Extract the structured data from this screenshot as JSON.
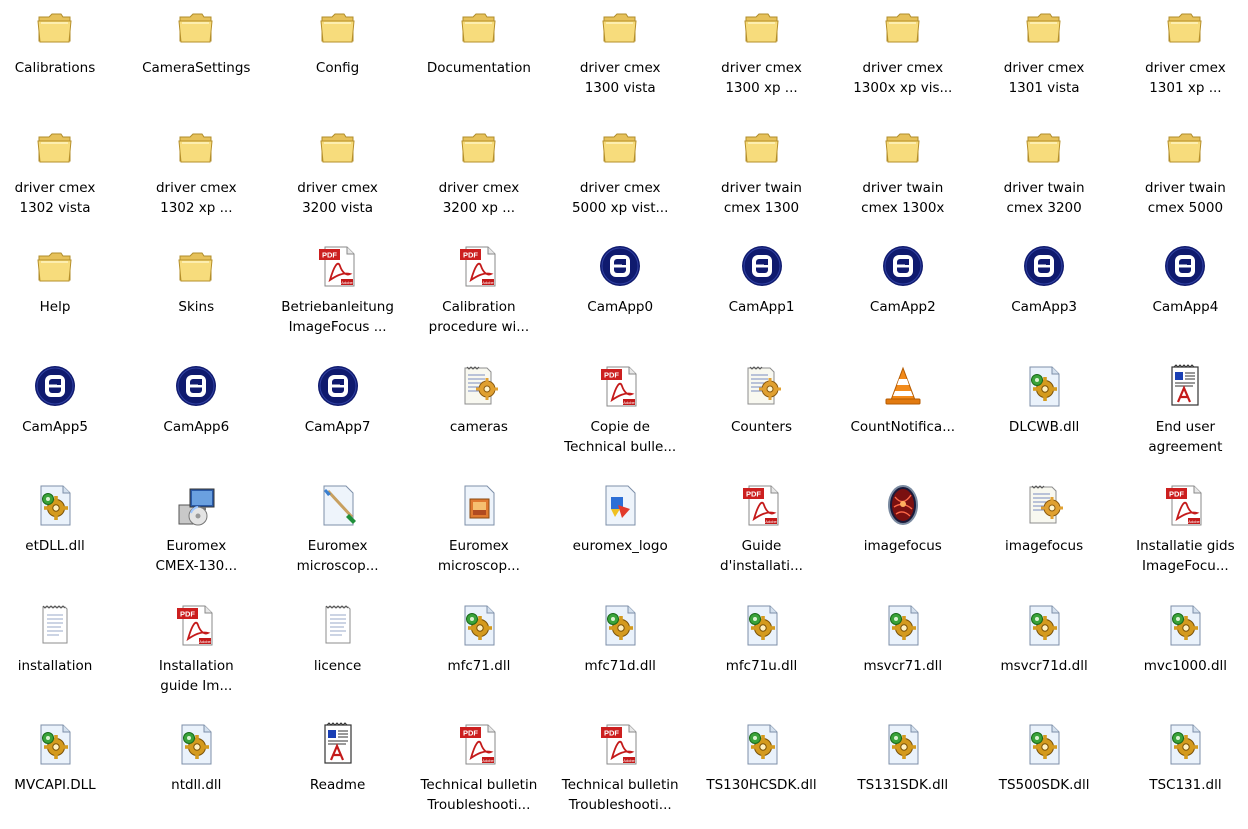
{
  "items": [
    {
      "label": "Calibrations",
      "icon": "folder-icon"
    },
    {
      "label": "CameraSettings",
      "icon": "folder-icon"
    },
    {
      "label": "Config",
      "icon": "folder-icon"
    },
    {
      "label": "Documentation",
      "icon": "folder-icon"
    },
    {
      "label": "driver cmex\n1300 vista",
      "icon": "folder-icon"
    },
    {
      "label": "driver cmex\n1300 xp ...",
      "icon": "folder-icon"
    },
    {
      "label": "driver cmex\n1300x xp vis...",
      "icon": "folder-icon"
    },
    {
      "label": "driver cmex\n1301 vista",
      "icon": "folder-icon"
    },
    {
      "label": "driver cmex\n1301 xp ...",
      "icon": "folder-icon"
    },
    {
      "label": "driver cmex\n1302 vista",
      "icon": "folder-icon"
    },
    {
      "label": "driver cmex\n1302 xp ...",
      "icon": "folder-icon"
    },
    {
      "label": "driver cmex\n3200 vista",
      "icon": "folder-icon"
    },
    {
      "label": "driver cmex\n3200 xp ...",
      "icon": "folder-icon"
    },
    {
      "label": "driver cmex\n5000 xp vist...",
      "icon": "folder-icon"
    },
    {
      "label": "driver twain\ncmex 1300",
      "icon": "folder-icon"
    },
    {
      "label": "driver twain\ncmex 1300x",
      "icon": "folder-icon"
    },
    {
      "label": "driver twain\ncmex 3200",
      "icon": "folder-icon"
    },
    {
      "label": "driver twain\ncmex 5000",
      "icon": "folder-icon"
    },
    {
      "label": "Help",
      "icon": "folder-icon"
    },
    {
      "label": "Skins",
      "icon": "folder-icon"
    },
    {
      "label": "Betriebanleitung\nImageFocus ...",
      "icon": "pdf-icon"
    },
    {
      "label": "Calibration\nprocedure wi...",
      "icon": "pdf-icon"
    },
    {
      "label": "CamApp0",
      "icon": "camapp-icon"
    },
    {
      "label": "CamApp1",
      "icon": "camapp-icon"
    },
    {
      "label": "CamApp2",
      "icon": "camapp-icon"
    },
    {
      "label": "CamApp3",
      "icon": "camapp-icon"
    },
    {
      "label": "CamApp4",
      "icon": "camapp-icon"
    },
    {
      "label": "CamApp5",
      "icon": "camapp-icon"
    },
    {
      "label": "CamApp6",
      "icon": "camapp-icon"
    },
    {
      "label": "CamApp7",
      "icon": "camapp-icon"
    },
    {
      "label": "cameras",
      "icon": "config-file-icon"
    },
    {
      "label": "Copie de\nTechnical bulle...",
      "icon": "pdf-icon"
    },
    {
      "label": "Counters",
      "icon": "config-file-icon"
    },
    {
      "label": "CountNotifica...",
      "icon": "vlc-cone-icon"
    },
    {
      "label": "DLCWB.dll",
      "icon": "dll-icon"
    },
    {
      "label": "End user\nagreement",
      "icon": "rtf-document-icon"
    },
    {
      "label": "etDLL.dll",
      "icon": "dll-icon"
    },
    {
      "label": "Euromex\nCMEX-130...",
      "icon": "installer-icon"
    },
    {
      "label": "Euromex\nmicroscop...",
      "icon": "paint-file-icon"
    },
    {
      "label": "Euromex\nmicroscop...",
      "icon": "image-file-icon"
    },
    {
      "label": "euromex_logo",
      "icon": "picture-file-icon"
    },
    {
      "label": "Guide\nd'installati...",
      "icon": "pdf-icon"
    },
    {
      "label": "imagefocus",
      "icon": "imagefocus-app-icon"
    },
    {
      "label": "imagefocus",
      "icon": "config-file-icon"
    },
    {
      "label": "Installatie gids\nImageFocu...",
      "icon": "pdf-icon"
    },
    {
      "label": "installation",
      "icon": "text-file-icon"
    },
    {
      "label": "Installation\nguide Im...",
      "icon": "pdf-icon"
    },
    {
      "label": "licence",
      "icon": "text-file-icon"
    },
    {
      "label": "mfc71.dll",
      "icon": "dll-icon"
    },
    {
      "label": "mfc71d.dll",
      "icon": "dll-icon"
    },
    {
      "label": "mfc71u.dll",
      "icon": "dll-icon"
    },
    {
      "label": "msvcr71.dll",
      "icon": "dll-icon"
    },
    {
      "label": "msvcr71d.dll",
      "icon": "dll-icon"
    },
    {
      "label": "mvc1000.dll",
      "icon": "dll-icon"
    },
    {
      "label": "MVCAPI.DLL",
      "icon": "dll-icon"
    },
    {
      "label": "ntdll.dll",
      "icon": "dll-icon"
    },
    {
      "label": "Readme",
      "icon": "rtf-document-icon"
    },
    {
      "label": "Technical bulletin\nTroubleshooti...",
      "icon": "pdf-icon"
    },
    {
      "label": "Technical bulletin\nTroubleshooti...",
      "icon": "pdf-icon"
    },
    {
      "label": "TS130HCSDK.dll",
      "icon": "dll-icon"
    },
    {
      "label": "TS131SDK.dll",
      "icon": "dll-icon"
    },
    {
      "label": "TS500SDK.dll",
      "icon": "dll-icon"
    },
    {
      "label": "TSC131.dll",
      "icon": "dll-icon"
    }
  ],
  "icon_text": {
    "pdf": "PDF",
    "adobe": "Adobe"
  }
}
